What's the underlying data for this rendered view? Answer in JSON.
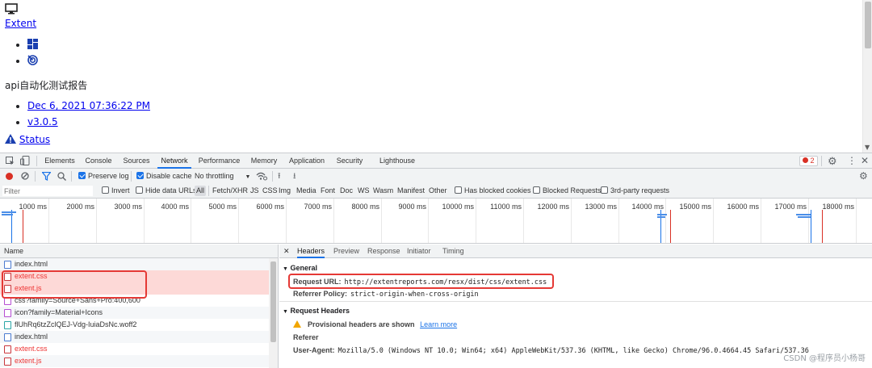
{
  "page": {
    "monitor_icon": "monitor-icon",
    "brand_link": "Extent",
    "nav_icons": [
      "dashboard-grid-icon",
      "radar-icon"
    ],
    "report_title": "api自动化测试报告",
    "meta_links": [
      "Dec 6, 2021 07:36:22 PM",
      "v3.0.5"
    ],
    "status_link": "Status"
  },
  "devtools": {
    "tabs": [
      "Elements",
      "Console",
      "Sources",
      "Network",
      "Performance",
      "Memory",
      "Application",
      "Security",
      "Lighthouse"
    ],
    "active_tab": "Network",
    "error_count": "2",
    "toolbar": {
      "preserve_log": "Preserve log",
      "disable_cache": "Disable cache",
      "throttling": "No throttling"
    },
    "filter": {
      "placeholder": "Filter",
      "invert": "Invert",
      "hide_data_urls": "Hide data URLs",
      "types": [
        "All",
        "Fetch/XHR",
        "JS",
        "CSS",
        "Img",
        "Media",
        "Font",
        "Doc",
        "WS",
        "Wasm",
        "Manifest",
        "Other"
      ],
      "has_blocked_cookies": "Has blocked cookies",
      "blocked_requests": "Blocked Requests",
      "third_party": "3rd-party requests"
    },
    "timeline_labels": [
      "1000 ms",
      "2000 ms",
      "3000 ms",
      "4000 ms",
      "5000 ms",
      "6000 ms",
      "7000 ms",
      "8000 ms",
      "9000 ms",
      "10000 ms",
      "11000 ms",
      "12000 ms",
      "13000 ms",
      "14000 ms",
      "15000 ms",
      "16000 ms",
      "17000 ms",
      "18000 ms"
    ],
    "requests": {
      "column": "Name",
      "rows": [
        {
          "name": "index.html",
          "kind": "doc"
        },
        {
          "name": "extent.css",
          "kind": "css"
        },
        {
          "name": "extent.js",
          "kind": "js"
        },
        {
          "name": "css?family=Source+Sans+Pro:400,600",
          "kind": "style"
        },
        {
          "name": "icon?family=Material+Icons",
          "kind": "style"
        },
        {
          "name": "flUhRq6tzZclQEJ-Vdg-IuiaDsNc.woff2",
          "kind": "font"
        },
        {
          "name": "index.html",
          "kind": "doc"
        },
        {
          "name": "extent.css",
          "kind": "css"
        },
        {
          "name": "extent.js",
          "kind": "js"
        }
      ]
    },
    "details": {
      "tabs": [
        "Headers",
        "Preview",
        "Response",
        "Initiator",
        "Timing"
      ],
      "active_tab": "Headers",
      "general_title": "General",
      "request_url_key": "Request URL:",
      "request_url_val": "http://extentreports.com/resx/dist/css/extent.css",
      "referrer_policy_key": "Referrer Policy:",
      "referrer_policy_val": "strict-origin-when-cross-origin",
      "request_headers_title": "Request Headers",
      "provisional_text": "Provisional headers are shown",
      "learn_more": "Learn more",
      "referer_key": "Referer",
      "user_agent_key": "User-Agent:",
      "user_agent_val": "Mozilla/5.0 (Windows NT 10.0; Win64; x64) AppleWebKit/537.36 (KHTML, like Gecko) Chrome/96.0.4664.45 Safari/537.36"
    },
    "watermark": "CSDN @程序员小杨哥"
  }
}
